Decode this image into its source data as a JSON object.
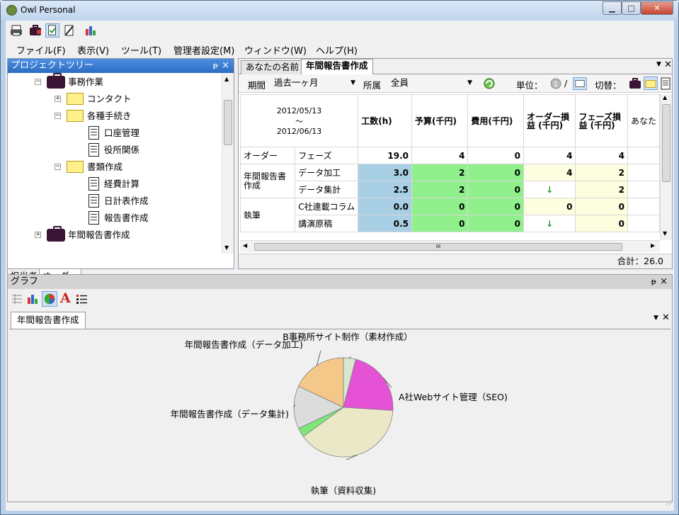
{
  "window": {
    "title": "Owl Personal",
    "minimize": "▁",
    "maximize": "□",
    "close": "✕"
  },
  "menu": [
    "ファイル(F)",
    "表示(V)",
    "ツール(T)",
    "管理者設定(M)",
    "ウィンドウ(W)",
    "ヘルプ(H)"
  ],
  "toolbar_icons": [
    "printer-icon",
    "briefcase-icon",
    "checked-document-icon",
    "pen-document-icon",
    "bar-chart-icon"
  ],
  "tree_panel": {
    "title": "プロジェクトツリー",
    "pin": "ᵽ",
    "close": "×",
    "items": [
      {
        "label": "事務作業",
        "icon": "briefcase-icon",
        "expander": "−"
      },
      {
        "label": "コンタクト",
        "icon": "folder-icon",
        "expander": "+"
      },
      {
        "label": "各種手続き",
        "icon": "folder-icon",
        "expander": "−"
      },
      {
        "label": "口座管理",
        "icon": "document-icon"
      },
      {
        "label": "役所関係",
        "icon": "document-icon"
      },
      {
        "label": "書類作成",
        "icon": "folder-icon",
        "expander": "−"
      },
      {
        "label": "経費計算",
        "icon": "document-icon"
      },
      {
        "label": "日計表作成",
        "icon": "document-icon"
      },
      {
        "label": "報告書作成",
        "icon": "document-icon"
      },
      {
        "label": "年間報告書作成",
        "icon": "briefcase-icon",
        "expander": "+"
      }
    ],
    "bottom_tabs": [
      "担当者",
      "オーダー"
    ]
  },
  "doc_panel": {
    "tabs": [
      "あなたの名前",
      "年間報告書作成"
    ],
    "filters": {
      "period_label": "期間",
      "period_value": "過去一ヶ月",
      "dept_label": "所属",
      "dept_value": "全員",
      "unit_label": "単位：",
      "unit_sep": "/",
      "switch_label": "切替："
    },
    "grid": {
      "date_from": "2012/05/13",
      "date_tilde": "〜",
      "date_to": "2012/06/13",
      "columns": [
        "工数(h)",
        "予算(千円)",
        "費用(千円)",
        "オーダー損益 (千円)",
        "フェーズ損益 (千円)",
        "あなた"
      ],
      "rows": [
        {
          "group": "オーダー",
          "phase": "フェーズ",
          "hours": "19.0",
          "budget": "4",
          "cost": "0",
          "order_pl": "4",
          "phase_pl": "4"
        },
        {
          "group": "年間報告書作成",
          "phase": "データ加工",
          "hours": "3.0",
          "budget": "2",
          "cost": "0",
          "order_pl": "4",
          "phase_pl": "2"
        },
        {
          "group": "",
          "phase": "データ集計",
          "hours": "2.5",
          "budget": "2",
          "cost": "0",
          "order_pl": "↓",
          "phase_pl": "2"
        },
        {
          "group": "執筆",
          "phase": "C社連載コラム",
          "hours": "0.0",
          "budget": "0",
          "cost": "0",
          "order_pl": "0",
          "phase_pl": "0"
        },
        {
          "group": "",
          "phase": "講演原稿",
          "hours": "0.5",
          "budget": "0",
          "cost": "0",
          "order_pl": "↓",
          "phase_pl": "0"
        }
      ],
      "hscroll_grip": "III"
    },
    "total": "合計：26.0"
  },
  "graph_panel": {
    "title": "グラフ",
    "pin": "ᵽ",
    "close": "×",
    "tab": "年間報告書作成",
    "toolbar_icons": [
      "grid-icon",
      "bar-chart-icon",
      "pie-chart-icon",
      "text-A-icon",
      "list-icon"
    ],
    "chart_data": {
      "type": "pie",
      "slices": [
        {
          "label": "B事務所サイト制作（素材作成）",
          "value": 4,
          "color": "#d8e7cf"
        },
        {
          "label": "A社Webサイト管理（SEO)",
          "value": 22,
          "color": "#e552d6"
        },
        {
          "label": "執筆（資料収集)",
          "value": 39,
          "color": "#ebe8c8"
        },
        {
          "label": "",
          "value": 3,
          "color": "#7fe67a"
        },
        {
          "label": "年間報告書作成（データ集計)",
          "value": 14,
          "color": "#dcdcdc"
        },
        {
          "label": "年間報告書作成（データ加工)",
          "value": 18,
          "color": "#f4c889"
        }
      ]
    }
  },
  "colors": {
    "title_bar": "#c0d5ee",
    "panel_header_active": "#2b6cc4",
    "hours_cell": "#a9cfe4",
    "money_cell": "#8ff08c",
    "pl_cell": "#fdfde0"
  }
}
